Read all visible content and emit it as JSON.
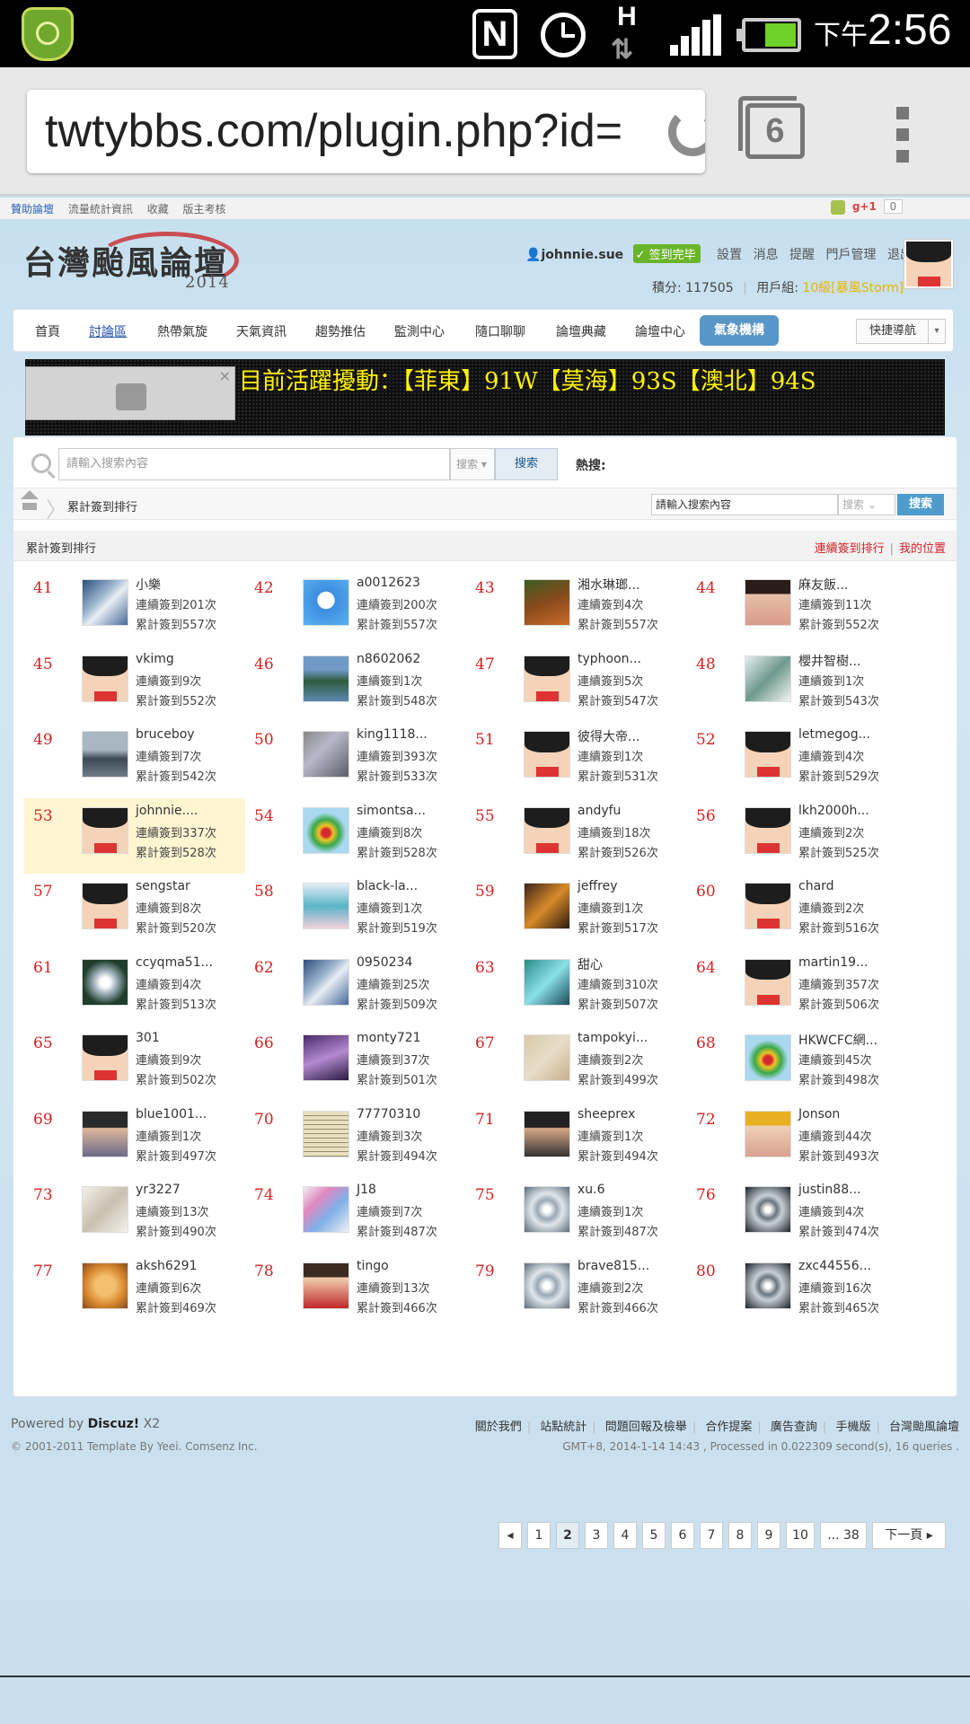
{
  "statusbar": {
    "ampm": "下午",
    "time": "2:56",
    "n_label": "N",
    "h_label": "H",
    "arrows": "⇅"
  },
  "browser": {
    "url": "twtybbs.com/plugin.php?id=",
    "tab_count": "6"
  },
  "topbar": {
    "links": [
      "贊助論壇",
      "流量統計資訊",
      "收藏",
      "版主考核"
    ],
    "gplus": "g+1",
    "gplus_count": "0"
  },
  "header": {
    "logo_text": "台灣颱風論壇",
    "logo_year": "2014",
    "username": "johnnie.sue",
    "sign_badge": "签到完毕",
    "links": [
      "設置",
      "消息",
      "提醒",
      "門戶管理",
      "退出"
    ],
    "points": "積分: 117505",
    "group_label": "用戶組:",
    "group_value": "10級[暴風Storm]"
  },
  "nav": {
    "items": [
      "首頁",
      "討論區",
      "熱帶氣旋",
      "天氣資訊",
      "趨勢推估",
      "監測中心",
      "隨口聊聊",
      "論壇典藏",
      "論壇中心"
    ],
    "pill": "氣象機構",
    "quick": "快捷導航"
  },
  "banner": {
    "text": "目前活躍擾動：【菲東】91W【莫海】93S【澳北】94S",
    "close": "×"
  },
  "search": {
    "placeholder": "請輸入搜索內容",
    "select": "搜索",
    "button": "搜索",
    "hot_label": "熱搜:"
  },
  "breadcrumb": {
    "title": "累計簽到排行",
    "search_value": "請輸入搜索內容",
    "select": "搜索",
    "button": "搜索"
  },
  "section": {
    "title": "累計簽到排行",
    "link1": "連續簽到排行",
    "link2": "我的位置"
  },
  "ranking": [
    {
      "rank": "41",
      "name": "小樂",
      "streak": "連續簽到201次",
      "total": "累計簽到557次",
      "avatar": "satellite"
    },
    {
      "rank": "42",
      "name": "a0012623",
      "streak": "連續簽到200次",
      "total": "累計簽到557次",
      "avatar": "blue-cartoon"
    },
    {
      "rank": "43",
      "name": "湘水琳瑯...",
      "streak": "連續簽到4次",
      "total": "累計簽到557次",
      "avatar": "plant"
    },
    {
      "rank": "44",
      "name": "麻友飯...",
      "streak": "連續簽到11次",
      "total": "累計簽到552次",
      "avatar": "girl"
    },
    {
      "rank": "45",
      "name": "vkimg",
      "streak": "連續簽到9次",
      "total": "累計簽到552次",
      "avatar": "default-face"
    },
    {
      "rank": "46",
      "name": "n8602062",
      "streak": "連續簽到1次",
      "total": "累計簽到548次",
      "avatar": "lake"
    },
    {
      "rank": "47",
      "name": "typhoon...",
      "streak": "連續簽到5次",
      "total": "累計簽到547次",
      "avatar": "default-face"
    },
    {
      "rank": "48",
      "name": "櫻井智樹...",
      "streak": "連續簽到1次",
      "total": "累計簽到543次",
      "avatar": "anime-mecha"
    },
    {
      "rank": "49",
      "name": "bruceboy",
      "streak": "連續簽到7次",
      "total": "累計簽到542次",
      "avatar": "harbor"
    },
    {
      "rank": "50",
      "name": "king1118...",
      "streak": "連續簽到393次",
      "total": "累計簽到533次",
      "avatar": "texture"
    },
    {
      "rank": "51",
      "name": "彼得大帝...",
      "streak": "連續簽到1次",
      "total": "累計簽到531次",
      "avatar": "default-face"
    },
    {
      "rank": "52",
      "name": "letmegog...",
      "streak": "連續簽到4次",
      "total": "累計簽到529次",
      "avatar": "default-face"
    },
    {
      "rank": "53",
      "name": "johnnie....",
      "streak": "連續簽到337次",
      "total": "累計簽到528次",
      "avatar": "default-face",
      "me": true
    },
    {
      "rank": "54",
      "name": "simontsa...",
      "streak": "連續簽到8次",
      "total": "累計簽到528次",
      "avatar": "radar"
    },
    {
      "rank": "55",
      "name": "andyfu",
      "streak": "連續簽到18次",
      "total": "累計簽到526次",
      "avatar": "default-face"
    },
    {
      "rank": "56",
      "name": "lkh2000h...",
      "streak": "連續簽到2次",
      "total": "累計簽到525次",
      "avatar": "default-face"
    },
    {
      "rank": "57",
      "name": "sengstar",
      "streak": "連續簽到8次",
      "total": "累計簽到520次",
      "avatar": "default-face"
    },
    {
      "rank": "58",
      "name": "black-la...",
      "streak": "連續簽到1次",
      "total": "累計簽到519次",
      "avatar": "anime-girl"
    },
    {
      "rank": "59",
      "name": "jeffrey",
      "streak": "連續簽到1次",
      "total": "累計簽到517次",
      "avatar": "anime-boy"
    },
    {
      "rank": "60",
      "name": "chard",
      "streak": "連續簽到2次",
      "total": "累計簽到516次",
      "avatar": "default-face"
    },
    {
      "rank": "61",
      "name": "ccyqma51...",
      "streak": "連續簽到4次",
      "total": "累計簽到513次",
      "avatar": "typhoon"
    },
    {
      "rank": "62",
      "name": "0950234",
      "streak": "連續簽到25次",
      "total": "累計簽到509次",
      "avatar": "satellite"
    },
    {
      "rank": "63",
      "name": "甜心",
      "streak": "連續簽到310次",
      "total": "累計簽到507次",
      "avatar": "teal-girl"
    },
    {
      "rank": "64",
      "name": "martin19...",
      "streak": "連續簽到357次",
      "total": "累計簽到506次",
      "avatar": "default-face"
    },
    {
      "rank": "65",
      "name": "301",
      "streak": "連續簽到9次",
      "total": "累計簽到502次",
      "avatar": "default-face"
    },
    {
      "rank": "66",
      "name": "monty721",
      "streak": "連續簽到37次",
      "total": "累計簽到501次",
      "avatar": "lightning"
    },
    {
      "rank": "67",
      "name": "tampokyi...",
      "streak": "連續簽到2次",
      "total": "累計簽到499次",
      "avatar": "map"
    },
    {
      "rank": "68",
      "name": "HKWCFC網...",
      "streak": "連續簽到45次",
      "total": "累計簽到498次",
      "avatar": "radar"
    },
    {
      "rank": "69",
      "name": "blue1001...",
      "streak": "連續簽到1次",
      "total": "累計簽到497次",
      "avatar": "person"
    },
    {
      "rank": "70",
      "name": "77770310",
      "streak": "連續簽到3次",
      "total": "累計簽到494次",
      "avatar": "newspaper"
    },
    {
      "rank": "71",
      "name": "sheeprex",
      "streak": "連續簽到1次",
      "total": "累計簽到494次",
      "avatar": "group-photo"
    },
    {
      "rank": "72",
      "name": "Jonson",
      "streak": "連續簽到44次",
      "total": "累計簽到493次",
      "avatar": "hat-person"
    },
    {
      "rank": "73",
      "name": "yr3227",
      "streak": "連續簽到13次",
      "total": "累計簽到490次",
      "avatar": "sketch"
    },
    {
      "rank": "74",
      "name": "J18",
      "streak": "連續簽到7次",
      "total": "累計簽到487次",
      "avatar": "colorful"
    },
    {
      "rank": "75",
      "name": "xu.6",
      "streak": "連續簽到1次",
      "total": "累計簽到487次",
      "avatar": "hurricane"
    },
    {
      "rank": "76",
      "name": "justin88...",
      "streak": "連續簽到4次",
      "total": "累計簽到474次",
      "avatar": "hurricane-dark"
    },
    {
      "rank": "77",
      "name": "aksh6291",
      "streak": "連續簽到6次",
      "total": "累計簽到469次",
      "avatar": "cat"
    },
    {
      "rank": "78",
      "name": "tingo",
      "streak": "連續簽到13次",
      "total": "累計簽到466次",
      "avatar": "chibi"
    },
    {
      "rank": "79",
      "name": "brave815...",
      "streak": "連續簽到2次",
      "total": "累計簽到466次",
      "avatar": "hurricane"
    },
    {
      "rank": "80",
      "name": "zxc44556...",
      "streak": "連續簽到16次",
      "total": "累計簽到465次",
      "avatar": "hurricane-dark"
    }
  ],
  "pager": {
    "prev": "◂",
    "pages": [
      "1",
      "2",
      "3",
      "4",
      "5",
      "6",
      "7",
      "8",
      "9",
      "10",
      "... 38"
    ],
    "current": "2",
    "next": "下一頁 ▸"
  },
  "footer": {
    "powered_prefix": "Powered by ",
    "powered_name": "Discuz!",
    "powered_ver": " X2",
    "copyright": "© 2001-2011 Template By Yeei. Comsenz Inc.",
    "links": [
      "關於我們",
      "站點統計",
      "問題回報及檢舉",
      "合作提案",
      "廣告查詢",
      "手機版",
      "台灣颱風論壇"
    ],
    "gmt": "GMT+8, 2014-1-14 14:43 , Processed in 0.022309 second(s), 16 queries ."
  },
  "colors": {
    "rank_red": "#d81f1f",
    "accent_blue": "#4e9ccb",
    "highlight": "#fff5d1",
    "banner_text": "#fff200"
  }
}
